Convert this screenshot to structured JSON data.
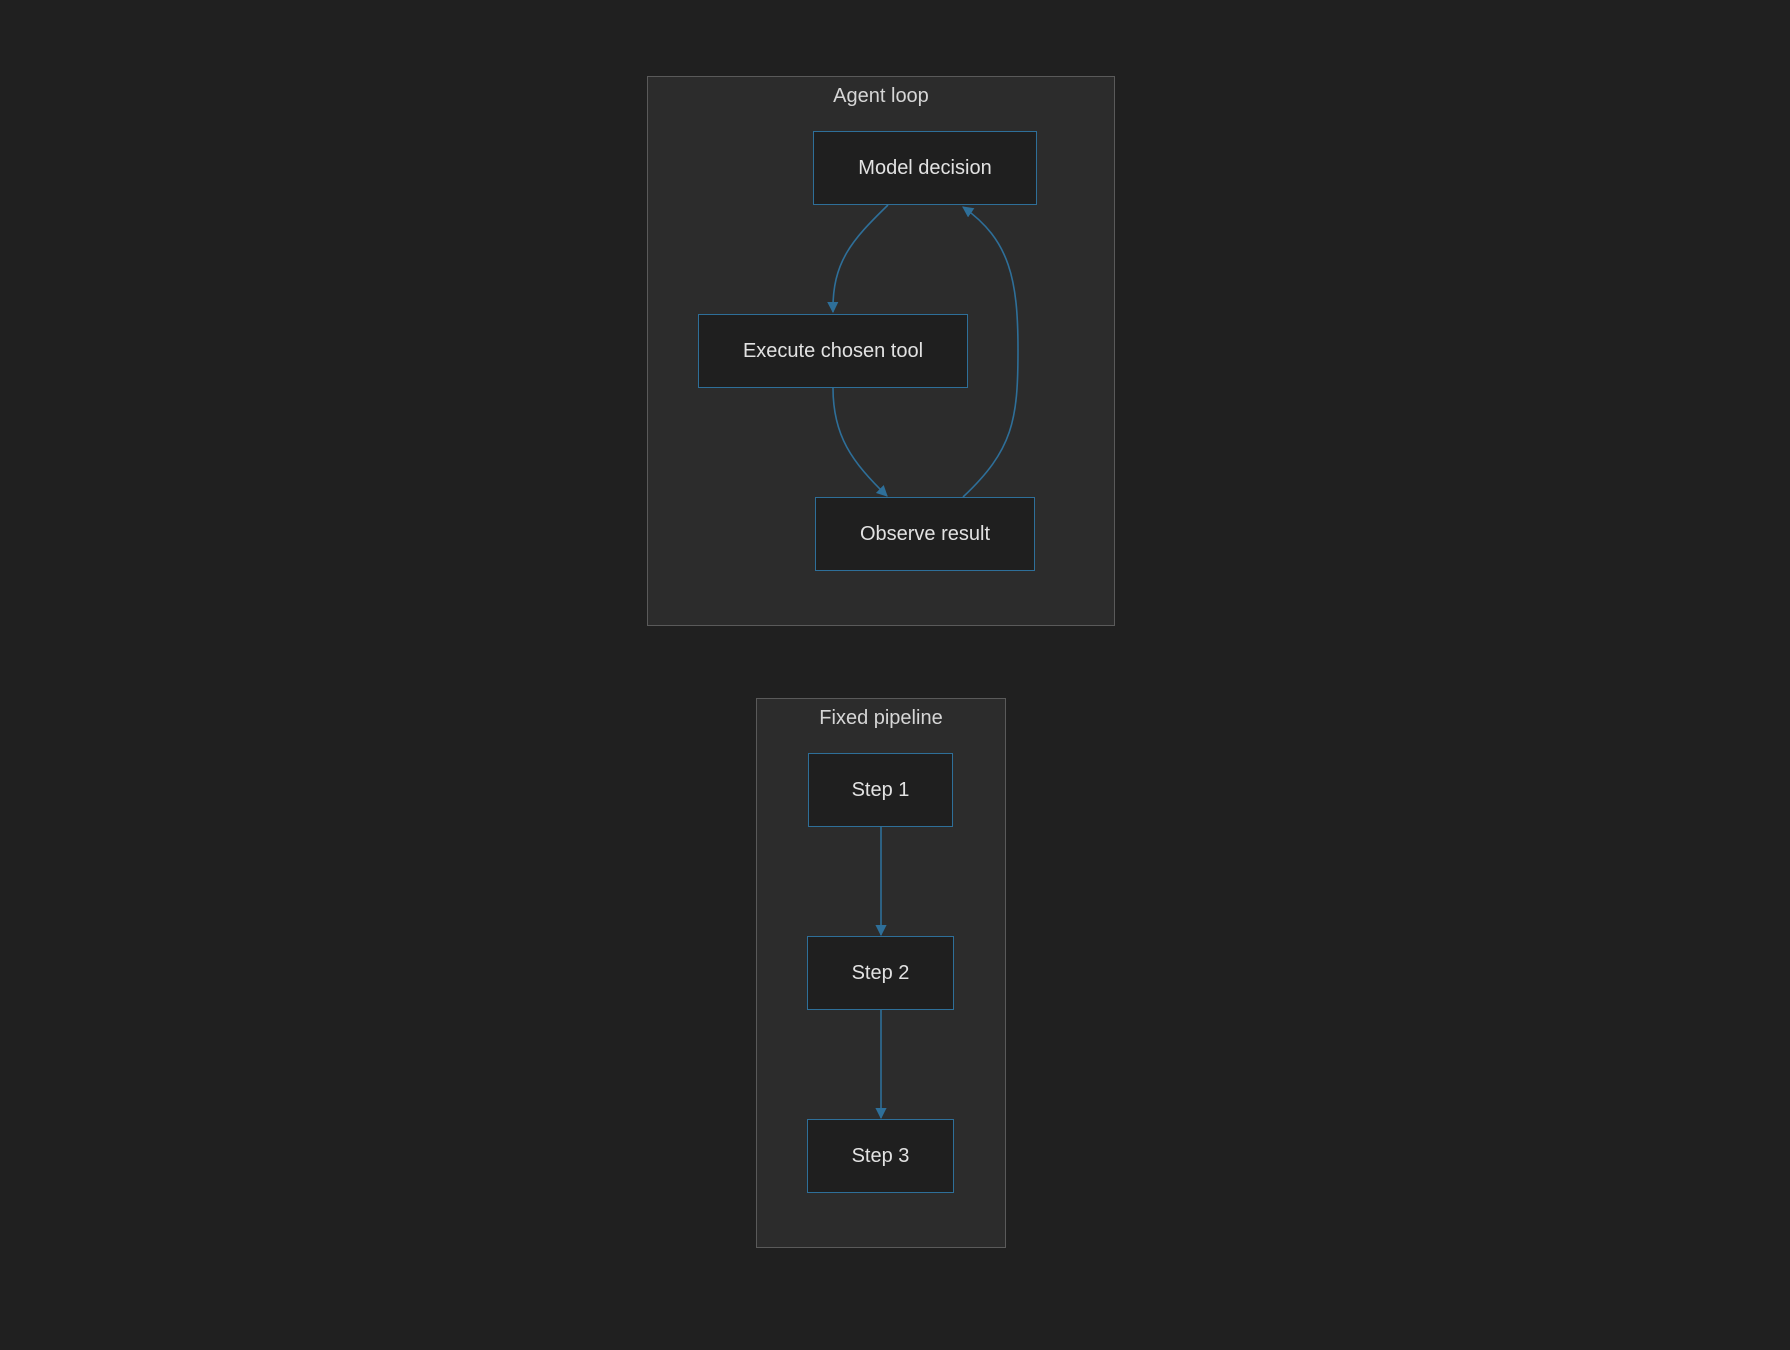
{
  "clusters": {
    "agent_loop": {
      "title": "Agent loop",
      "nodes": {
        "model_decision": "Model decision",
        "execute_tool": "Execute chosen tool",
        "observe_result": "Observe result"
      },
      "edges": [
        {
          "from": "Model decision",
          "to": "Execute chosen tool"
        },
        {
          "from": "Execute chosen tool",
          "to": "Observe result"
        },
        {
          "from": "Observe result",
          "to": "Model decision"
        }
      ]
    },
    "fixed_pipeline": {
      "title": "Fixed pipeline",
      "nodes": {
        "step1": "Step 1",
        "step2": "Step 2",
        "step3": "Step 3"
      },
      "edges": [
        {
          "from": "Step 1",
          "to": "Step 2"
        },
        {
          "from": "Step 2",
          "to": "Step 3"
        }
      ]
    }
  },
  "colors": {
    "background": "#202020",
    "cluster_fill": "#2c2c2c",
    "cluster_border": "#5a5a5a",
    "node_fill": "#1f1f1f",
    "node_border": "#2e6f99",
    "edge": "#2e6f99",
    "text": "#e2e2e2"
  }
}
